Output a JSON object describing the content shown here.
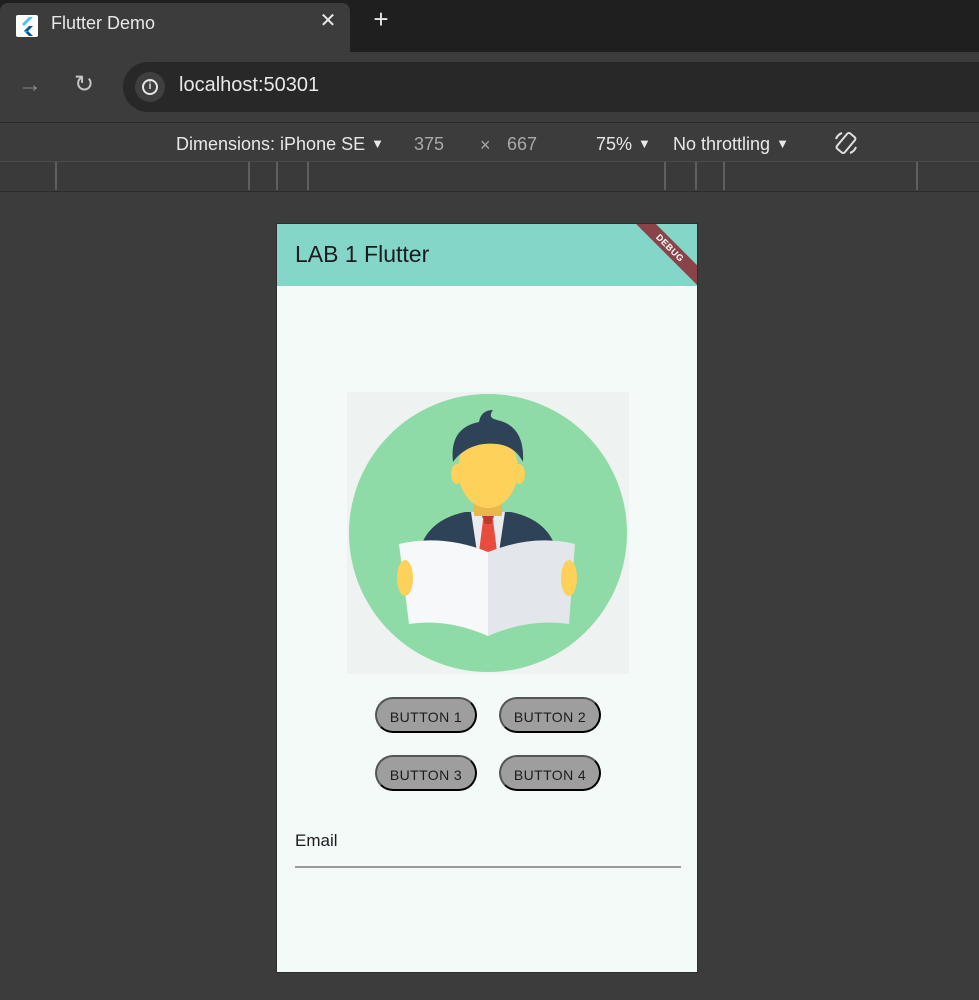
{
  "browser": {
    "tab_title": "Flutter Demo",
    "tab_close_glyph": "✕",
    "new_tab_glyph": "+",
    "url_host": "localhost",
    "url_port": ":50301",
    "forward_glyph": "→",
    "reload_glyph": "↻",
    "info_glyph": "i"
  },
  "devtools": {
    "dimensions_label": "Dimensions: iPhone SE",
    "width_value": "375",
    "times_glyph": "×",
    "height_value": "667",
    "zoom": "75%",
    "throttling": "No throttling",
    "caret_glyph": "▼"
  },
  "app": {
    "title": "LAB 1 Flutter",
    "debug_banner": "DEBUG",
    "buttons": [
      "BUTTON 1",
      "BUTTON 2",
      "BUTTON 3",
      "BUTTON 4"
    ],
    "email_label": "Email",
    "colors": {
      "app_bar": "#84d6c9",
      "background": "#f3faf8",
      "button": "#9e9e9e",
      "avatar_circle": "#8fdba7"
    }
  }
}
